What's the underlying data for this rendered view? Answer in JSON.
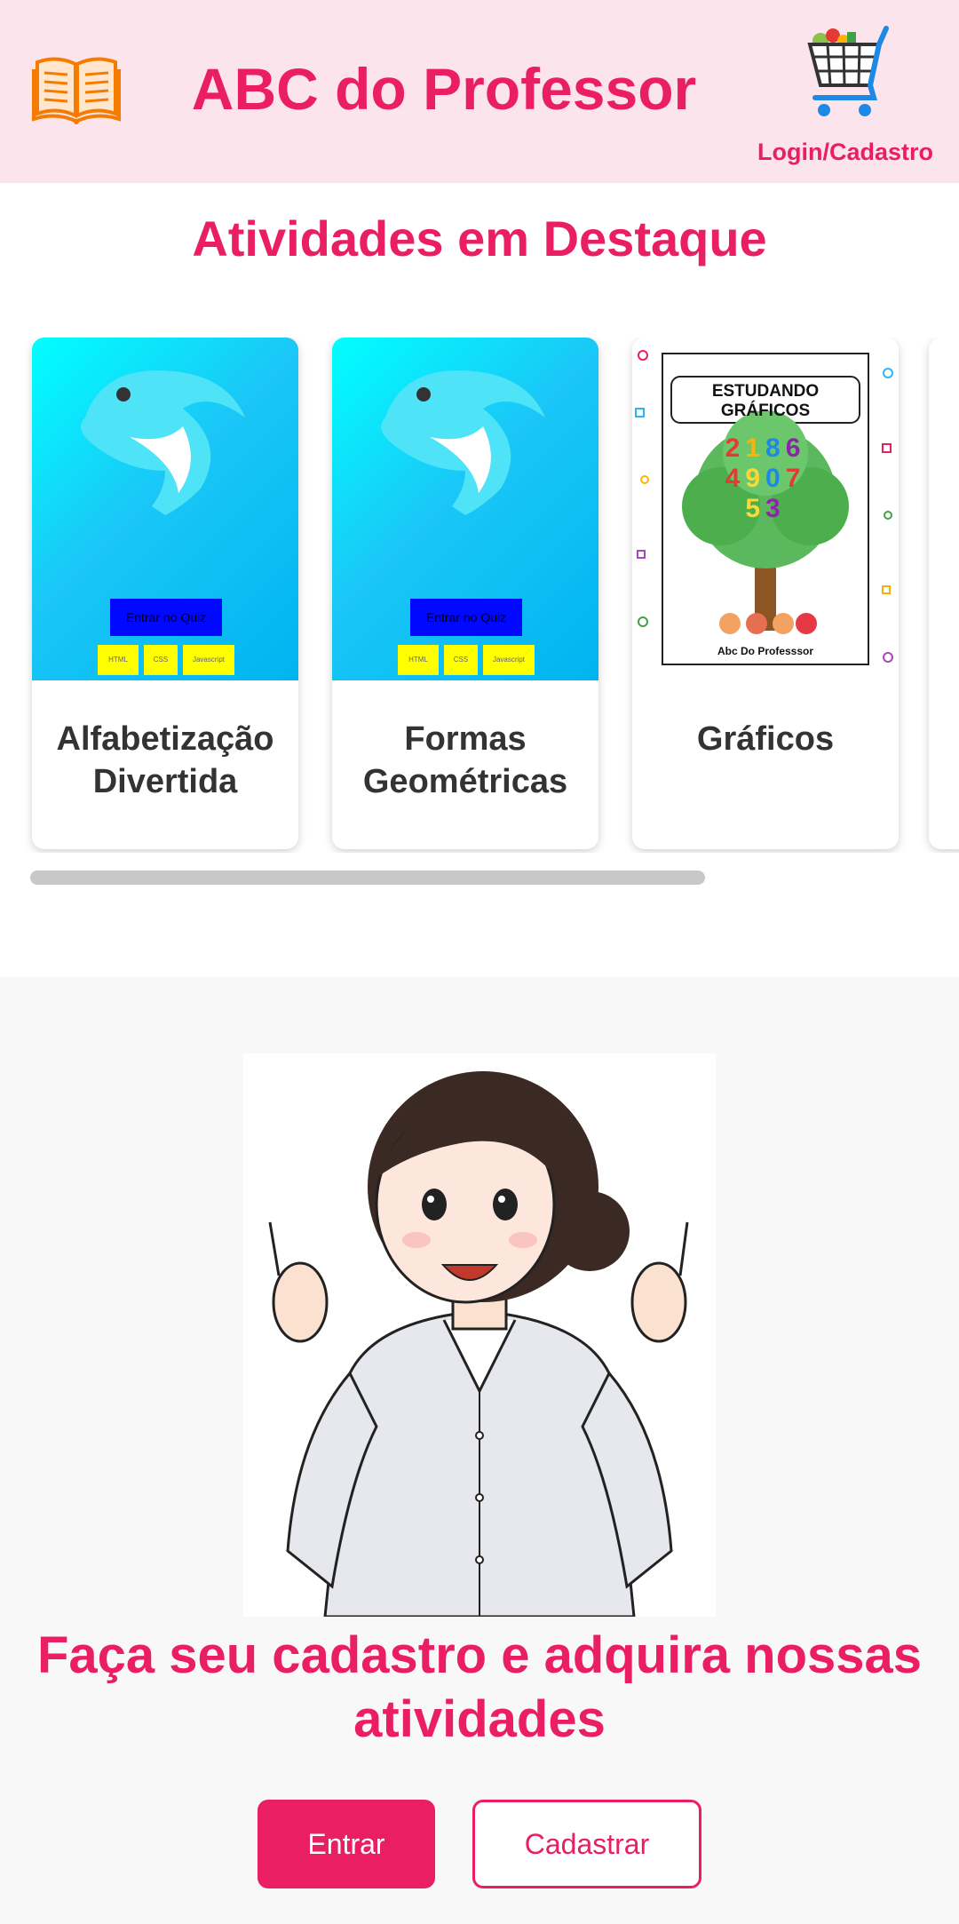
{
  "header": {
    "title": "ABC do Professor",
    "logo_icon": "open-book-icon",
    "cart_icon": "shopping-cart-icon",
    "login_label": "Login/Cadastro"
  },
  "featured": {
    "title": "Atividades em Destaque",
    "cards": [
      {
        "title": "Alfabetização Divertida",
        "image": "dolphin-quiz-cover",
        "quiz_button": "Entrar no Quiz",
        "chips": [
          "HTML",
          "CSS",
          "Javascript"
        ]
      },
      {
        "title": "Formas Geométricas",
        "image": "dolphin-quiz-cover",
        "quiz_button": "Entrar no Quiz",
        "chips": [
          "HTML",
          "CSS",
          "Javascript"
        ]
      },
      {
        "title": "Gráficos",
        "image": "estudando-graficos-cover",
        "cover_title": "ESTUDANDO GRÁFICOS",
        "cover_footer": "Abc Do Professsor"
      }
    ]
  },
  "signup": {
    "image": "teacher-illustration",
    "text": "Faça seu cadastro e adquira nossas atividades",
    "enter_label": "Entrar",
    "register_label": "Cadastrar"
  },
  "colors": {
    "accent": "#e91e63",
    "header_bg": "#fce4ec",
    "section_bg": "#f8f8f8"
  }
}
